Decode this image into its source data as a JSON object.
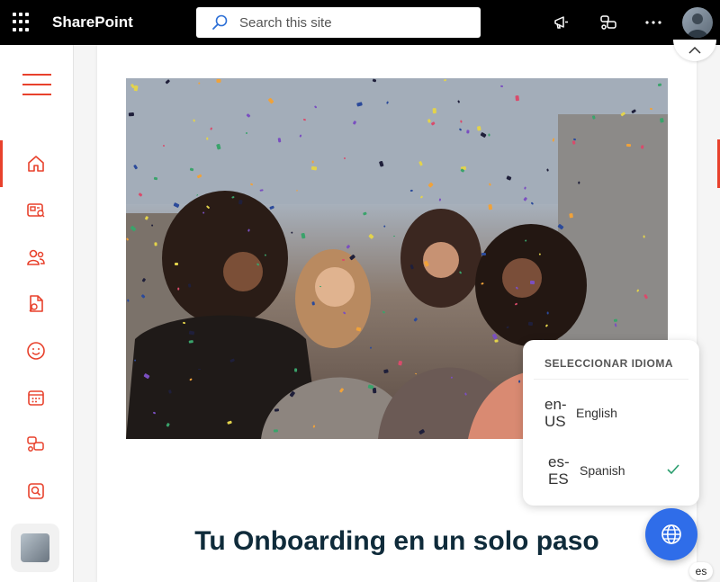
{
  "app": {
    "brand": "SharePoint"
  },
  "search": {
    "placeholder": "Search this site"
  },
  "topbar_icons": [
    "waffle-icon",
    "megaphone-icon",
    "chat-icon",
    "more-icon",
    "avatar"
  ],
  "sidebar": {
    "items": [
      "home-icon",
      "news-icon",
      "people-icon",
      "document-search-icon",
      "smiley-icon",
      "calendar-icon",
      "chat-icon",
      "search-icon"
    ]
  },
  "page": {
    "heading": "Tu Onboarding en un solo paso"
  },
  "language_picker": {
    "title": "SELECCIONAR IDIOMA",
    "options": [
      {
        "code": "en-US",
        "code_line1": "en-",
        "code_line2": "US",
        "name": "English",
        "selected": false
      },
      {
        "code": "es-ES",
        "code_line1": "es-",
        "code_line2": "ES",
        "name": "Spanish",
        "selected": true
      }
    ],
    "current": "es"
  },
  "colors": {
    "accent": "#e8412c",
    "fab": "#2f6de9",
    "heading": "#0f2b3a",
    "check": "#2a9d6e"
  }
}
